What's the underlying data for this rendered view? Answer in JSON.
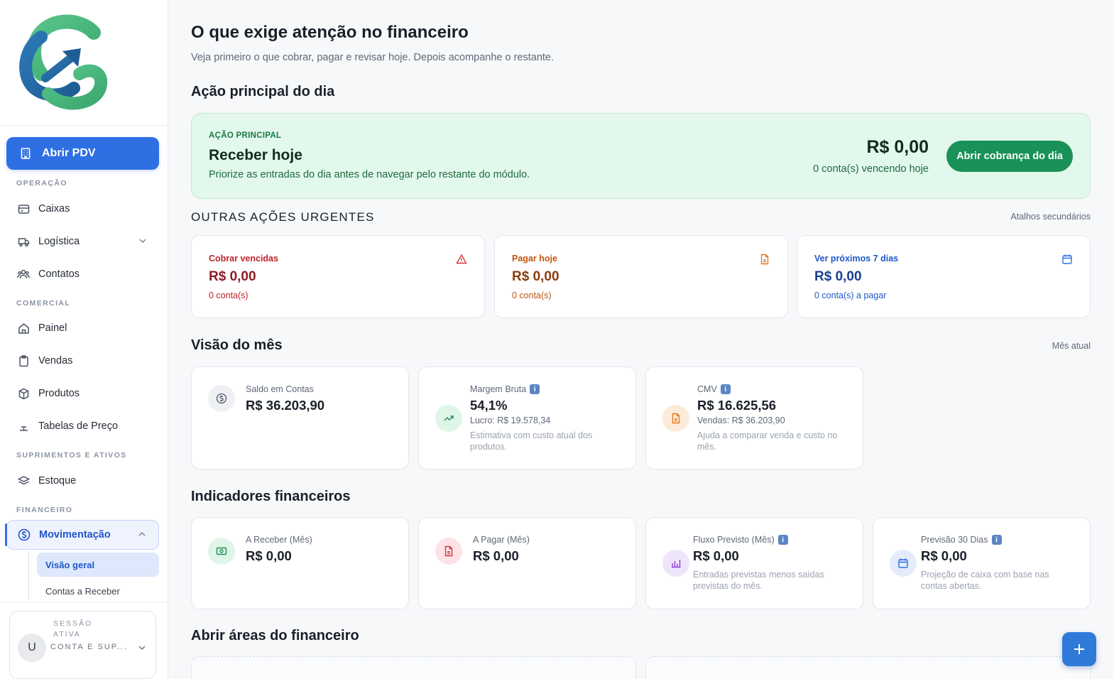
{
  "sidebar": {
    "pdv_label": "Abrir PDV",
    "sections": {
      "operacao": "OPERAÇÃO",
      "comercial": "COMERCIAL",
      "suprimentos": "SUPRIMENTOS E ATIVOS",
      "financeiro": "FINANCEIRO"
    },
    "items": {
      "caixas": "Caixas",
      "logistica": "Logística",
      "contatos": "Contatos",
      "painel": "Painel",
      "vendas": "Vendas",
      "produtos": "Produtos",
      "tabelas": "Tabelas de Preço",
      "estoque": "Estoque",
      "movimentacao": "Movimentação"
    },
    "subitems": {
      "visao_geral": "Visão geral",
      "contas_receber": "Contas a Receber"
    },
    "session": {
      "label": "SESSÃO ATIVA",
      "avatar": "U",
      "name": "CONTA E SUP..."
    }
  },
  "header": {
    "title": "O que exige atenção no financeiro",
    "subtitle": "Veja primeiro o que cobrar, pagar e revisar hoje. Depois acompanhe o restante."
  },
  "primary": {
    "section_title": "Ação principal do dia",
    "eyebrow": "AÇÃO PRINCIPAL",
    "title": "Receber hoje",
    "description": "Priorize as entradas do dia antes de navegar pelo restante do módulo.",
    "amount": "R$ 0,00",
    "count": "0 conta(s) vencendo hoje",
    "button": "Abrir cobrança do dia"
  },
  "urgent": {
    "title": "OUTRAS AÇÕES URGENTES",
    "right_label": "Atalhos secundários",
    "cards": [
      {
        "label": "Cobrar vencidas",
        "amount": "R$ 0,00",
        "count": "0 conta(s)",
        "icon": "warning-icon",
        "color": "#c0222b"
      },
      {
        "label": "Pagar hoje",
        "amount": "R$ 0,00",
        "count": "0 conta(s)",
        "icon": "document-icon",
        "color": "#c2540f"
      },
      {
        "label": "Ver próximos 7 dias",
        "amount": "R$ 0,00",
        "count": "0 conta(s) a pagar",
        "icon": "calendar-icon",
        "color": "#1f56c9"
      }
    ]
  },
  "month": {
    "title": "Visão do mês",
    "right_label": "Mês atual",
    "cards": [
      {
        "label": "Saldo em Contas",
        "value": "R$ 36.203,90",
        "line": "",
        "note": ""
      },
      {
        "label": "Margem Bruta",
        "value": "54,1%",
        "line": "Lucro: R$ 19.578,34",
        "note": "Estimativa com custo atual dos produtos."
      },
      {
        "label": "CMV",
        "value": "R$ 16.625,56",
        "line": "Vendas: R$ 36.203,90",
        "note": "Ajuda a comparar venda e custo no mês."
      }
    ]
  },
  "indicators": {
    "title": "Indicadores financeiros",
    "cards": [
      {
        "label": "A Receber (Mês)",
        "value": "R$ 0,00",
        "note": ""
      },
      {
        "label": "A Pagar (Mês)",
        "value": "R$ 0,00",
        "note": ""
      },
      {
        "label": "Fluxo Previsto (Mês)",
        "value": "R$ 0,00",
        "note": "Entradas previstas menos saídas previstas do mês."
      },
      {
        "label": "Previsão 30 Dias",
        "value": "R$ 0,00",
        "note": "Projeção de caixa com base nas contas abertas."
      }
    ]
  },
  "areas": {
    "title": "Abrir áreas do financeiro"
  },
  "info_glyph": "i",
  "colors": {
    "accent": "#2f6fe4",
    "success": "#199157",
    "success_bg": "#e3f8ec",
    "danger": "#c0222b",
    "warning": "#c2540f"
  }
}
